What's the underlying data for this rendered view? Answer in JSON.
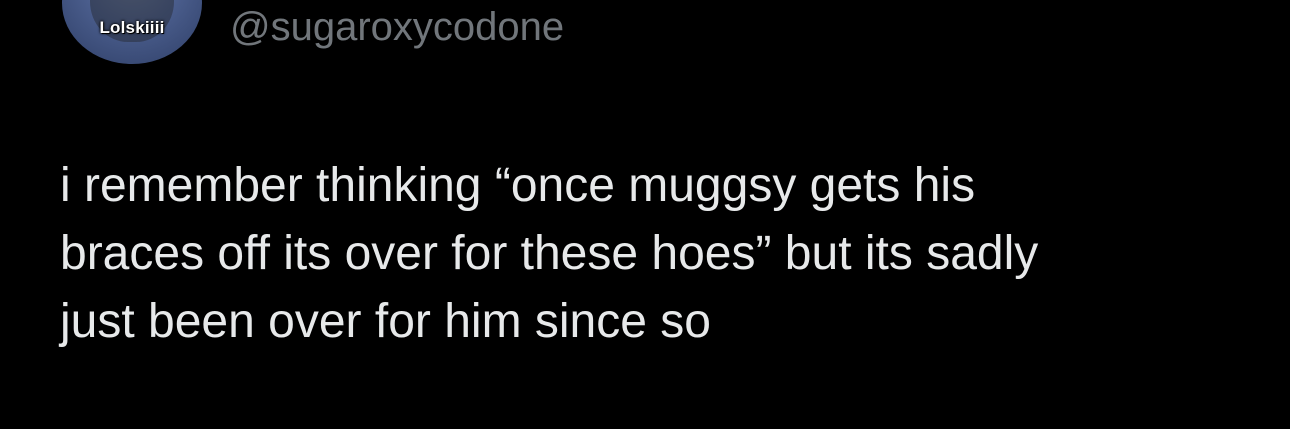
{
  "colors": {
    "background": "#000000",
    "text": "#e7e9ea",
    "handle": "#71767b"
  },
  "author": {
    "avatar_label": "Lolskiiii",
    "handle": "@sugaroxycodone"
  },
  "tweet": {
    "lines": [
      "i remember thinking “once muggsy gets his",
      "braces off its over for these hoes” but its sadly",
      "just been over for him since so"
    ]
  }
}
